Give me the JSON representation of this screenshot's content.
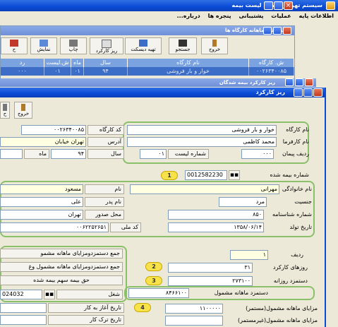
{
  "app": {
    "title": "سیستم تهیه و ارسال لیست بیمه"
  },
  "menu": [
    "اطلاعات پایه",
    "عملیات",
    "پشتیبانی",
    "پنجره ها",
    "درباره..."
  ],
  "win_list": {
    "title": "لیست های ماهانه کارگاه ها",
    "toolbar": [
      "خروج",
      "جستجو",
      "تهیه دیسکت",
      "ریز کارکرد",
      "چاپ",
      "نمایش",
      "ح"
    ],
    "columns": [
      "ش. کارگاه",
      "نام کارگاه",
      "سال",
      "ماه",
      "ش.لیست",
      "رد"
    ],
    "row": [
      "۰۰۲۶۳۴۰۰۸۵",
      "خوار و بار فروشی",
      "۹۴",
      "۰۱",
      "۰۱",
      "۰۰۰"
    ]
  },
  "win_insured": {
    "title": "ریز کارکرد بیمه شدگان"
  },
  "win_detail": {
    "title": "ریز کارکرد",
    "exit_label": "خروج",
    "left_btn_label": "ح"
  },
  "workshop": {
    "name_label": "نام کارگاه",
    "name": "خوار و بار فروشی",
    "code_label": "کد کارگاه",
    "code": "۰۰۲۶۳۴۰۰۸۵",
    "employer_label": "نام کارفرما",
    "employer": "محمد کاظمی",
    "address_label": "آدرس",
    "address": "تهران خیابان",
    "contract_label": "ردیف پیمان",
    "contract": "۰۰۰",
    "list_no_label": "شماره لیست",
    "list_no": "۰۱",
    "year_label": "سال",
    "year": "۹۴",
    "month_label": "ماه"
  },
  "insurance_no": {
    "label": "شماره بیمه شده",
    "value": "0012582230"
  },
  "person": {
    "lastname_label": "نام خانوادگی",
    "lastname": "مهرانی",
    "firstname_label": "نام",
    "firstname": "مسعود",
    "gender_label": "جنسیت",
    "gender": "مرد",
    "father_label": "نام پدر",
    "father": "علی",
    "idno_label": "شماره شناسنامه",
    "idno": "۸۵۰",
    "issue_label": "محل صدور",
    "issue": "تهران",
    "birth_label": "تاریخ تولد",
    "birth": "۱۳۵۸/۰۶/۱۴",
    "nid_label": "کد ملی",
    "nid": "۰۰۶۲۲۵۲۶۵۱"
  },
  "work": {
    "row_label": "ردیف",
    "row": "۱",
    "days_label": "روزهای کارکرد",
    "days": "۳۱",
    "daily_label": "دستمزد روزانه",
    "daily": "۲۷۳۱۰۰",
    "monthly_label": "دستمزد ماهانه مشمول",
    "monthly": "۸۴۶۶۱۰۰",
    "benefit_label": "مزایای ماهانه مشمول(مستمر)",
    "benefit": "۱۱۰۰۰۰۰",
    "nonbenefit_label": "مزایای ماهانه مشمول(غیرمستمر)",
    "nonbenefit": "",
    "start_label": "تاریخ آغاز به کار",
    "end_label": "تاریخ ترک کار",
    "sum1_label": "جمع دستمزدومزایای ماهانه مشمو",
    "sum2_label": "جمع دستمزدومزایای ماهانه مشمول وغ",
    "share_label": "حق بیمه سهم بیمه شده",
    "job_label": "شغل",
    "job": "024032"
  },
  "badges": [
    "1",
    "2",
    "3",
    "4"
  ],
  "colors": {
    "group_border": "#8bc06a",
    "badge": "#f7e24a",
    "title_active": "#0a4bd6"
  }
}
